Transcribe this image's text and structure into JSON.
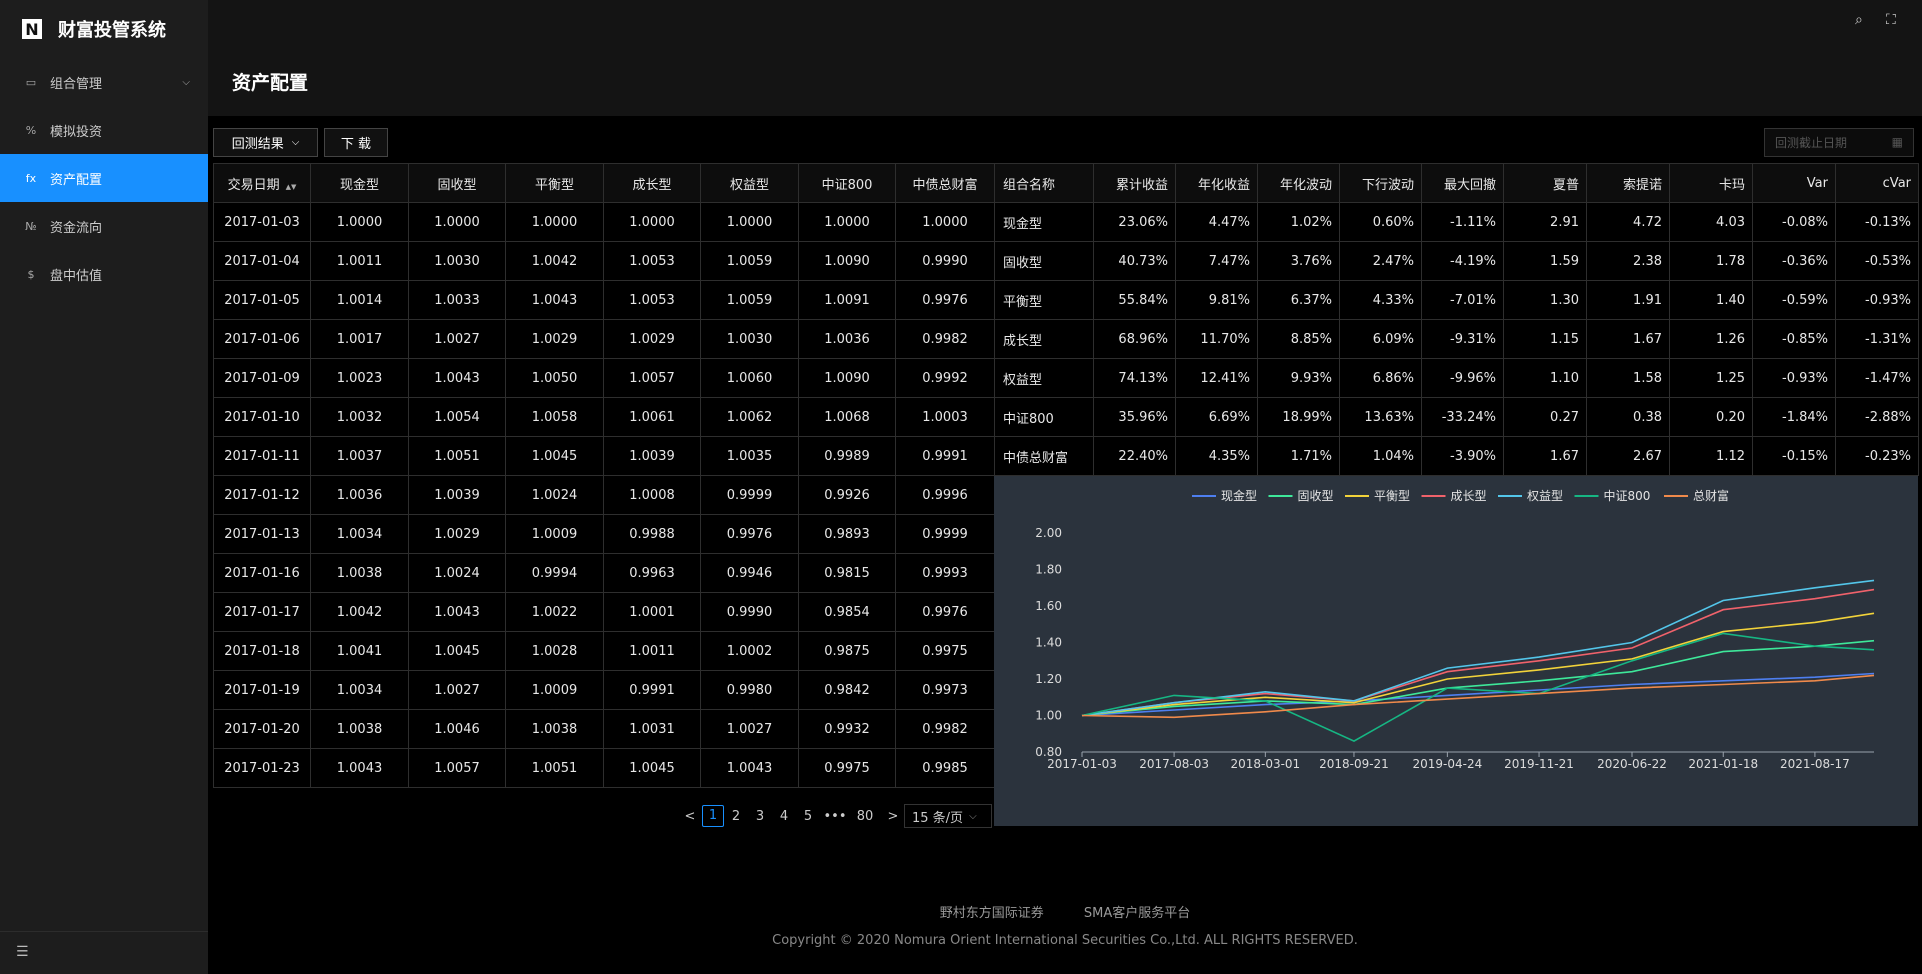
{
  "app": {
    "title": "财富投管系统",
    "logo_letter": "N"
  },
  "sidebar": {
    "items": [
      {
        "icon": "portfolio-icon",
        "glyph": "▭",
        "label": "组合管理",
        "has_caret": true
      },
      {
        "icon": "percent-icon",
        "glyph": "%",
        "label": "模拟投资"
      },
      {
        "icon": "function-icon",
        "glyph": "fx",
        "label": "资产配置",
        "active": true
      },
      {
        "icon": "number-icon",
        "glyph": "№",
        "label": "资金流向"
      },
      {
        "icon": "dollar-icon",
        "glyph": "$",
        "label": "盘中估值"
      }
    ]
  },
  "page": {
    "title": "资产配置"
  },
  "toolbar": {
    "result_select": "回测结果",
    "download": "下 载",
    "date_placeholder": "回测截止日期"
  },
  "nav_table": {
    "headers": [
      "交易日期",
      "现金型",
      "固收型",
      "平衡型",
      "成长型",
      "权益型",
      "中证800",
      "中债总财富"
    ],
    "rows": [
      [
        "2017-01-03",
        "1.0000",
        "1.0000",
        "1.0000",
        "1.0000",
        "1.0000",
        "1.0000",
        "1.0000"
      ],
      [
        "2017-01-04",
        "1.0011",
        "1.0030",
        "1.0042",
        "1.0053",
        "1.0059",
        "1.0090",
        "0.9990"
      ],
      [
        "2017-01-05",
        "1.0014",
        "1.0033",
        "1.0043",
        "1.0053",
        "1.0059",
        "1.0091",
        "0.9976"
      ],
      [
        "2017-01-06",
        "1.0017",
        "1.0027",
        "1.0029",
        "1.0029",
        "1.0030",
        "1.0036",
        "0.9982"
      ],
      [
        "2017-01-09",
        "1.0023",
        "1.0043",
        "1.0050",
        "1.0057",
        "1.0060",
        "1.0090",
        "0.9992"
      ],
      [
        "2017-01-10",
        "1.0032",
        "1.0054",
        "1.0058",
        "1.0061",
        "1.0062",
        "1.0068",
        "1.0003"
      ],
      [
        "2017-01-11",
        "1.0037",
        "1.0051",
        "1.0045",
        "1.0039",
        "1.0035",
        "0.9989",
        "0.9991"
      ],
      [
        "2017-01-12",
        "1.0036",
        "1.0039",
        "1.0024",
        "1.0008",
        "0.9999",
        "0.9926",
        "0.9996"
      ],
      [
        "2017-01-13",
        "1.0034",
        "1.0029",
        "1.0009",
        "0.9988",
        "0.9976",
        "0.9893",
        "0.9999"
      ],
      [
        "2017-01-16",
        "1.0038",
        "1.0024",
        "0.9994",
        "0.9963",
        "0.9946",
        "0.9815",
        "0.9993"
      ],
      [
        "2017-01-17",
        "1.0042",
        "1.0043",
        "1.0022",
        "1.0001",
        "0.9990",
        "0.9854",
        "0.9976"
      ],
      [
        "2017-01-18",
        "1.0041",
        "1.0045",
        "1.0028",
        "1.0011",
        "1.0002",
        "0.9875",
        "0.9975"
      ],
      [
        "2017-01-19",
        "1.0034",
        "1.0027",
        "1.0009",
        "0.9991",
        "0.9980",
        "0.9842",
        "0.9973"
      ],
      [
        "2017-01-20",
        "1.0038",
        "1.0046",
        "1.0038",
        "1.0031",
        "1.0027",
        "0.9932",
        "0.9982"
      ],
      [
        "2017-01-23",
        "1.0043",
        "1.0057",
        "1.0051",
        "1.0045",
        "1.0043",
        "0.9975",
        "0.9985"
      ]
    ]
  },
  "stats_table": {
    "headers": [
      "组合名称",
      "累计收益",
      "年化收益",
      "年化波动",
      "下行波动",
      "最大回撤",
      "夏普",
      "索提诺",
      "卡玛",
      "Var",
      "cVar"
    ],
    "rows": [
      [
        "现金型",
        "23.06%",
        "4.47%",
        "1.02%",
        "0.60%",
        "-1.11%",
        "2.91",
        "4.72",
        "4.03",
        "-0.08%",
        "-0.13%"
      ],
      [
        "固收型",
        "40.73%",
        "7.47%",
        "3.76%",
        "2.47%",
        "-4.19%",
        "1.59",
        "2.38",
        "1.78",
        "-0.36%",
        "-0.53%"
      ],
      [
        "平衡型",
        "55.84%",
        "9.81%",
        "6.37%",
        "4.33%",
        "-7.01%",
        "1.30",
        "1.91",
        "1.40",
        "-0.59%",
        "-0.93%"
      ],
      [
        "成长型",
        "68.96%",
        "11.70%",
        "8.85%",
        "6.09%",
        "-9.31%",
        "1.15",
        "1.67",
        "1.26",
        "-0.85%",
        "-1.31%"
      ],
      [
        "权益型",
        "74.13%",
        "12.41%",
        "9.93%",
        "6.86%",
        "-9.96%",
        "1.10",
        "1.58",
        "1.25",
        "-0.93%",
        "-1.47%"
      ],
      [
        "中证800",
        "35.96%",
        "6.69%",
        "18.99%",
        "13.63%",
        "-33.24%",
        "0.27",
        "0.38",
        "0.20",
        "-1.84%",
        "-2.88%"
      ],
      [
        "中债总财富",
        "22.40%",
        "4.35%",
        "1.71%",
        "1.04%",
        "-3.90%",
        "1.67",
        "2.67",
        "1.12",
        "-0.15%",
        "-0.23%"
      ]
    ]
  },
  "chart_data": {
    "type": "line",
    "x": [
      "2017-01-03",
      "2017-08-03",
      "2018-03-01",
      "2018-09-21",
      "2019-04-24",
      "2019-11-21",
      "2020-06-22",
      "2021-01-18",
      "2021-08-17",
      "2021-12-31"
    ],
    "xticks": [
      "2017-01-03",
      "2017-08-03",
      "2018-03-01",
      "2018-09-21",
      "2019-04-24",
      "2019-11-21",
      "2020-06-22",
      "2021-01-18",
      "2021-08-17"
    ],
    "yticks": [
      "2.00",
      "1.80",
      "1.60",
      "1.40",
      "1.20",
      "1.00",
      "0.80"
    ],
    "ylim": [
      0.8,
      2.0
    ],
    "series": [
      {
        "name": "现金型",
        "color": "#4e7ff0",
        "values": [
          1.0,
          1.03,
          1.06,
          1.08,
          1.11,
          1.14,
          1.17,
          1.19,
          1.21,
          1.23
        ]
      },
      {
        "name": "固收型",
        "color": "#3ee89a",
        "values": [
          1.0,
          1.05,
          1.08,
          1.06,
          1.15,
          1.19,
          1.24,
          1.35,
          1.38,
          1.41
        ]
      },
      {
        "name": "平衡型",
        "color": "#f2d33a",
        "values": [
          1.0,
          1.06,
          1.1,
          1.07,
          1.2,
          1.25,
          1.31,
          1.46,
          1.51,
          1.56
        ]
      },
      {
        "name": "成长型",
        "color": "#f0626b",
        "values": [
          1.0,
          1.07,
          1.12,
          1.08,
          1.24,
          1.3,
          1.37,
          1.58,
          1.64,
          1.69
        ]
      },
      {
        "name": "权益型",
        "color": "#53c6ea",
        "values": [
          1.0,
          1.07,
          1.13,
          1.08,
          1.26,
          1.32,
          1.4,
          1.63,
          1.7,
          1.74
        ]
      },
      {
        "name": "中证800",
        "color": "#16b683",
        "values": [
          1.0,
          1.11,
          1.08,
          0.86,
          1.15,
          1.12,
          1.3,
          1.45,
          1.38,
          1.36
        ]
      },
      {
        "name": "总财富",
        "color": "#f08a4b",
        "values": [
          1.0,
          0.99,
          1.02,
          1.06,
          1.09,
          1.12,
          1.15,
          1.17,
          1.19,
          1.22
        ]
      }
    ]
  },
  "pagination": {
    "prev": "<",
    "pages": [
      "1",
      "2",
      "3",
      "4",
      "5"
    ],
    "ellipsis": "•••",
    "last": "80",
    "next": ">",
    "page_size": "15 条/页"
  },
  "footer": {
    "link1": "野村东方国际证券",
    "link2": "SMA客户服务平台",
    "copyright": "Copyright © 2020 Nomura Orient International Securities Co.,Ltd. ALL RIGHTS RESERVED."
  }
}
